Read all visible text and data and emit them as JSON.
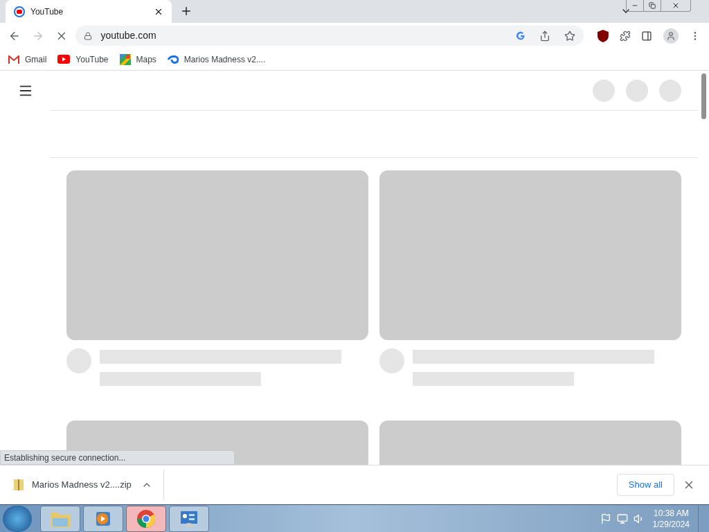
{
  "tabs": [
    {
      "title": "YouTube",
      "selected": true
    }
  ],
  "toolbar": {
    "url": "youtube.com",
    "loading": true
  },
  "bookmarks": [
    {
      "kind": "gmail",
      "label": "Gmail"
    },
    {
      "kind": "youtube",
      "label": "YouTube"
    },
    {
      "kind": "maps",
      "label": "Maps"
    },
    {
      "kind": "site",
      "label": "Marios Madness v2...."
    }
  ],
  "status_bubble": "Establishing secure connection...",
  "download_shelf": {
    "file": "Marios Madness v2....zip",
    "button": "Show all"
  },
  "taskbar": {
    "apps": [
      {
        "kind": "explorer",
        "selected": false
      },
      {
        "kind": "media",
        "selected": false
      },
      {
        "kind": "chrome",
        "selected": true
      },
      {
        "kind": "control",
        "selected": false
      }
    ],
    "time": "10:38 AM",
    "date": "1/29/2024"
  }
}
